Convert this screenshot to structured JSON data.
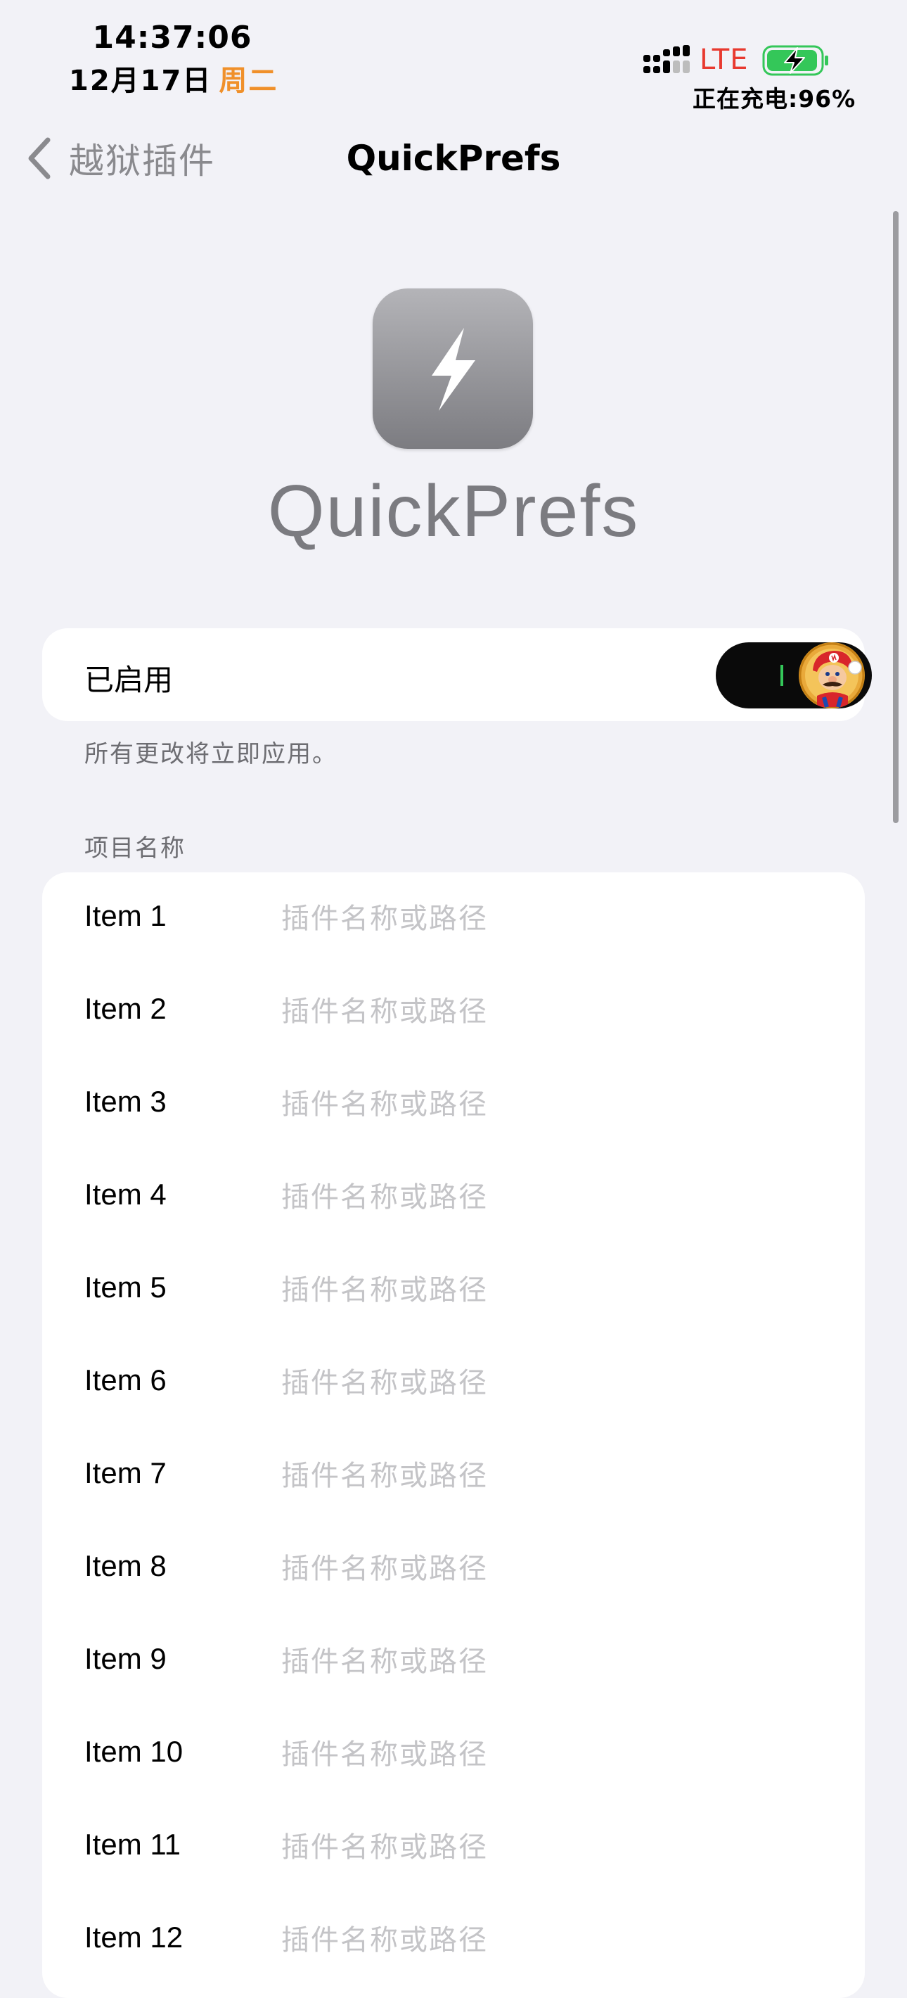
{
  "status_bar": {
    "time": "14:37:06",
    "date": "12月17日",
    "weekday": "周二",
    "network": "LTE",
    "charging_text": "正在充电:96%",
    "battery_level": 0.96,
    "accent_orange": "#f0902a",
    "network_red": "#e8392f"
  },
  "nav": {
    "back_label": "越狱插件",
    "title": "QuickPrefs"
  },
  "header": {
    "app_icon": "lightning-bolt",
    "app_name": "QuickPrefs"
  },
  "enable": {
    "label": "已启用",
    "state": true,
    "footnote": "所有更改将立即应用。"
  },
  "items_section": {
    "header": "项目名称",
    "placeholder": "插件名称或路径",
    "items": [
      {
        "label": "Item 1",
        "value": ""
      },
      {
        "label": "Item 2",
        "value": ""
      },
      {
        "label": "Item 3",
        "value": ""
      },
      {
        "label": "Item 4",
        "value": ""
      },
      {
        "label": "Item 5",
        "value": ""
      },
      {
        "label": "Item 6",
        "value": ""
      },
      {
        "label": "Item 7",
        "value": ""
      },
      {
        "label": "Item 8",
        "value": ""
      },
      {
        "label": "Item 9",
        "value": ""
      },
      {
        "label": "Item 10",
        "value": ""
      },
      {
        "label": "Item 11",
        "value": ""
      },
      {
        "label": "Item 12",
        "value": ""
      }
    ]
  }
}
